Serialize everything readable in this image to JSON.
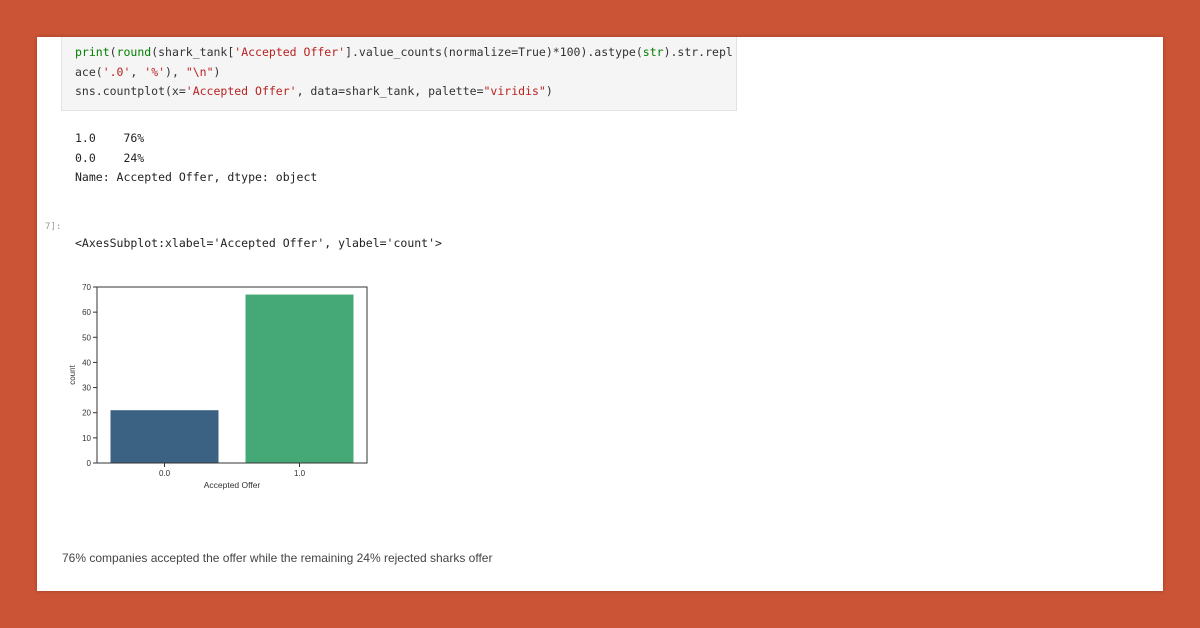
{
  "code": {
    "line1_fn": "print",
    "line1_a": "(",
    "line1_round": "round",
    "line1_b": "(shark_tank[",
    "line1_str": "'Accepted Offer'",
    "line1_c": "].value_counts(normalize=True)*100).astype(",
    "line1_strkw": "str",
    "line1_d": ").str.repl",
    "line2_a": "ace(",
    "line2_s1": "'.0'",
    "line2_b": ", ",
    "line2_s2": "'%'",
    "line2_c": "), ",
    "line2_s3": "\"\\n\"",
    "line2_d": ")",
    "line3_a": "sns.countplot(x=",
    "line3_s1": "'Accepted Offer'",
    "line3_b": ", data=shark_tank, palette=",
    "line3_s2": "\"viridis\"",
    "line3_c": ")"
  },
  "output": {
    "row1": "1.0    76%",
    "row2": "0.0    24%",
    "row3": "Name: Accepted Offer, dtype: object",
    "prompt": "7]:",
    "axes_repr": "<AxesSubplot:xlabel='Accepted Offer', ylabel='count'>"
  },
  "chart_data": {
    "type": "bar",
    "categories": [
      "0.0",
      "1.0"
    ],
    "values": [
      21,
      67
    ],
    "colors": [
      "#3b6282",
      "#45a977"
    ],
    "xlabel": "Accepted Offer",
    "ylabel": "count",
    "ylim": [
      0,
      70
    ],
    "yticks": [
      0,
      10,
      20,
      30,
      40,
      50,
      60,
      70
    ],
    "grid": false
  },
  "caption": "76% companies accepted the offer while the remaining 24% rejected sharks offer"
}
